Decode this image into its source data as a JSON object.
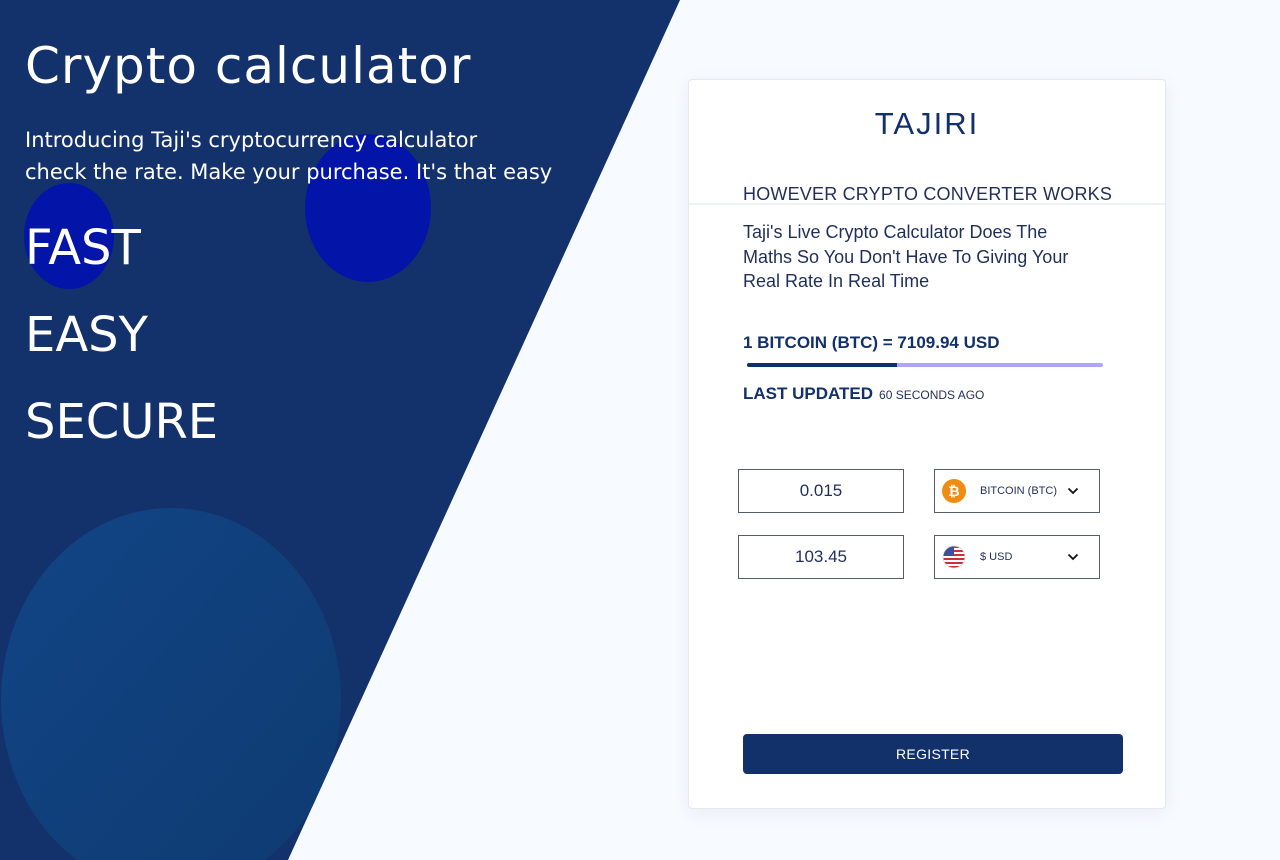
{
  "hero": {
    "title": "Crypto calculator",
    "subtitle_line1": "Introducing Taji's cryptocurrency calculator",
    "subtitle_line2": "check the rate. Make your purchase. It's that easy",
    "words": [
      "FAST",
      "EASY",
      "SECURE"
    ]
  },
  "colors": {
    "panel": "#13316a",
    "accent": "#12306a",
    "bubble_blue": "#0314a8",
    "bitcoin": "#f08c12",
    "progress_track": "#b1a6f5"
  },
  "card": {
    "brand": "TAJIRI",
    "section_heading": "HOWEVER CRYPTO CONVERTER WORKS",
    "description": "Taji's  Live Crypto Calculator Does The Maths So You Don't Have To Giving Your Real Rate In Real Time",
    "rate": "1 BITCOIN (BTC) = 7109.94 USD",
    "progress_fraction": 0.42,
    "last_updated_label": "LAST UPDATED",
    "last_updated_value": "60 SECONDS AGO",
    "converter": {
      "crypto_amount": "0.015",
      "crypto_currency": "BITCOIN (BTC)",
      "crypto_icon": "bitcoin-icon",
      "fiat_amount": "103.45",
      "fiat_currency": "$ USD",
      "fiat_icon": "us-flag-icon"
    },
    "register_label": "REGISTER"
  }
}
